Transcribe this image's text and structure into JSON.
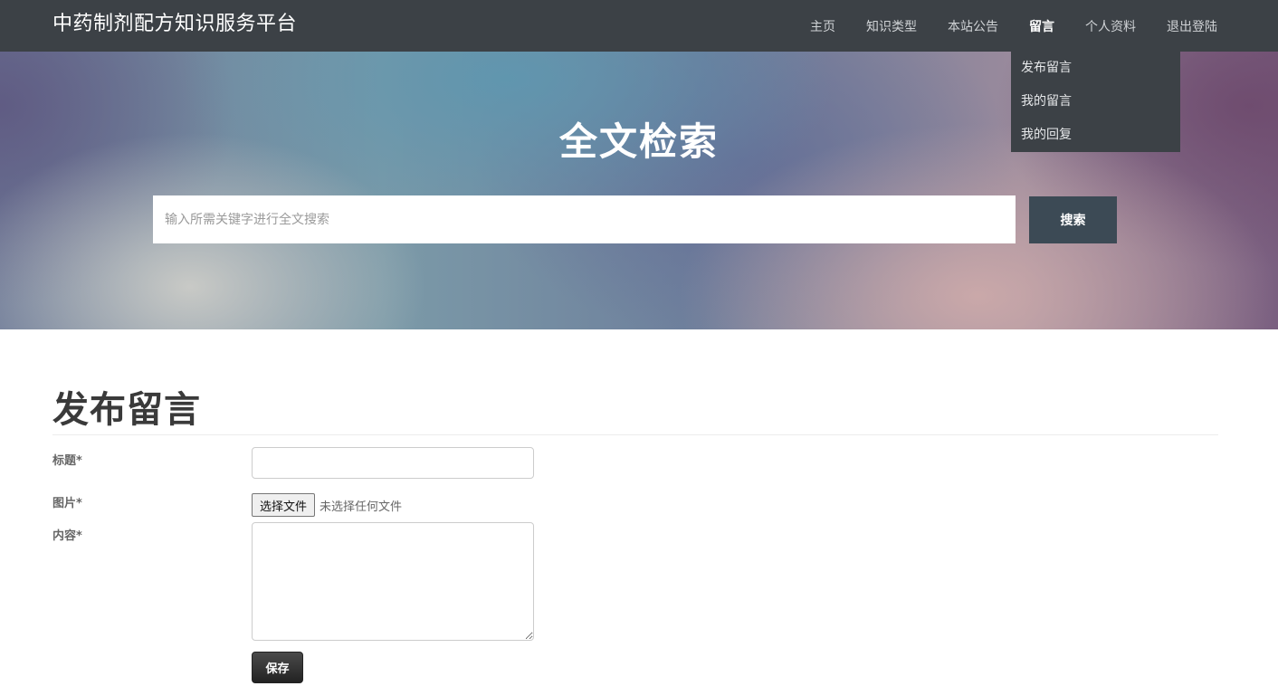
{
  "navbar": {
    "brand": "中药制剂配方知识服务平台",
    "items": [
      {
        "label": "主页"
      },
      {
        "label": "知识类型"
      },
      {
        "label": "本站公告"
      },
      {
        "label": "留言",
        "active": true
      },
      {
        "label": "个人资料"
      },
      {
        "label": "退出登陆"
      }
    ],
    "dropdown": [
      "发布留言",
      "我的留言",
      "我的回复"
    ]
  },
  "hero": {
    "title": "全文检索",
    "search_placeholder": "输入所需关键字进行全文搜索",
    "search_button": "搜索"
  },
  "form": {
    "page_title": "发布留言",
    "title_label": "标题*",
    "image_label": "图片*",
    "content_label": "内容*",
    "title_value": "",
    "file_button": "选择文件",
    "file_status": "未选择任何文件",
    "content_value": "",
    "save_button": "保存"
  },
  "colors": {
    "navbar_bg": "#3c4146",
    "search_button_bg": "#3c4a55",
    "save_button_bg": "#222222"
  }
}
